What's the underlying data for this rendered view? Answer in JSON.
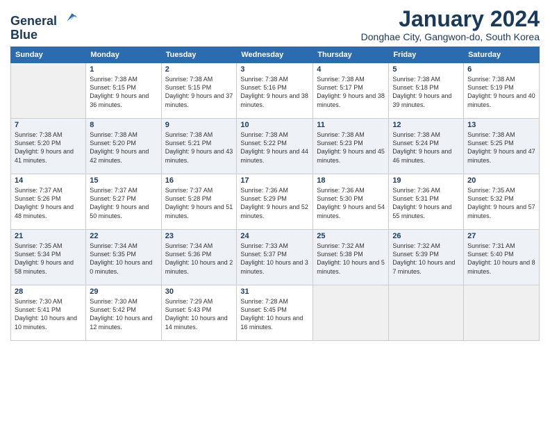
{
  "logo": {
    "line1": "General",
    "line2": "Blue"
  },
  "title": "January 2024",
  "subtitle": "Donghae City, Gangwon-do, South Korea",
  "days_of_week": [
    "Sunday",
    "Monday",
    "Tuesday",
    "Wednesday",
    "Thursday",
    "Friday",
    "Saturday"
  ],
  "weeks": [
    [
      {
        "empty": true
      },
      {
        "date": "1",
        "sunrise": "7:38 AM",
        "sunset": "5:15 PM",
        "daylight": "9 hours and 36 minutes."
      },
      {
        "date": "2",
        "sunrise": "7:38 AM",
        "sunset": "5:15 PM",
        "daylight": "9 hours and 37 minutes."
      },
      {
        "date": "3",
        "sunrise": "7:38 AM",
        "sunset": "5:16 PM",
        "daylight": "9 hours and 38 minutes."
      },
      {
        "date": "4",
        "sunrise": "7:38 AM",
        "sunset": "5:17 PM",
        "daylight": "9 hours and 38 minutes."
      },
      {
        "date": "5",
        "sunrise": "7:38 AM",
        "sunset": "5:18 PM",
        "daylight": "9 hours and 39 minutes."
      },
      {
        "date": "6",
        "sunrise": "7:38 AM",
        "sunset": "5:19 PM",
        "daylight": "9 hours and 40 minutes."
      }
    ],
    [
      {
        "date": "7",
        "sunrise": "7:38 AM",
        "sunset": "5:20 PM",
        "daylight": "9 hours and 41 minutes."
      },
      {
        "date": "8",
        "sunrise": "7:38 AM",
        "sunset": "5:20 PM",
        "daylight": "9 hours and 42 minutes."
      },
      {
        "date": "9",
        "sunrise": "7:38 AM",
        "sunset": "5:21 PM",
        "daylight": "9 hours and 43 minutes."
      },
      {
        "date": "10",
        "sunrise": "7:38 AM",
        "sunset": "5:22 PM",
        "daylight": "9 hours and 44 minutes."
      },
      {
        "date": "11",
        "sunrise": "7:38 AM",
        "sunset": "5:23 PM",
        "daylight": "9 hours and 45 minutes."
      },
      {
        "date": "12",
        "sunrise": "7:38 AM",
        "sunset": "5:24 PM",
        "daylight": "9 hours and 46 minutes."
      },
      {
        "date": "13",
        "sunrise": "7:38 AM",
        "sunset": "5:25 PM",
        "daylight": "9 hours and 47 minutes."
      }
    ],
    [
      {
        "date": "14",
        "sunrise": "7:37 AM",
        "sunset": "5:26 PM",
        "daylight": "9 hours and 48 minutes."
      },
      {
        "date": "15",
        "sunrise": "7:37 AM",
        "sunset": "5:27 PM",
        "daylight": "9 hours and 50 minutes."
      },
      {
        "date": "16",
        "sunrise": "7:37 AM",
        "sunset": "5:28 PM",
        "daylight": "9 hours and 51 minutes."
      },
      {
        "date": "17",
        "sunrise": "7:36 AM",
        "sunset": "5:29 PM",
        "daylight": "9 hours and 52 minutes."
      },
      {
        "date": "18",
        "sunrise": "7:36 AM",
        "sunset": "5:30 PM",
        "daylight": "9 hours and 54 minutes."
      },
      {
        "date": "19",
        "sunrise": "7:36 AM",
        "sunset": "5:31 PM",
        "daylight": "9 hours and 55 minutes."
      },
      {
        "date": "20",
        "sunrise": "7:35 AM",
        "sunset": "5:32 PM",
        "daylight": "9 hours and 57 minutes."
      }
    ],
    [
      {
        "date": "21",
        "sunrise": "7:35 AM",
        "sunset": "5:34 PM",
        "daylight": "9 hours and 58 minutes."
      },
      {
        "date": "22",
        "sunrise": "7:34 AM",
        "sunset": "5:35 PM",
        "daylight": "10 hours and 0 minutes."
      },
      {
        "date": "23",
        "sunrise": "7:34 AM",
        "sunset": "5:36 PM",
        "daylight": "10 hours and 2 minutes."
      },
      {
        "date": "24",
        "sunrise": "7:33 AM",
        "sunset": "5:37 PM",
        "daylight": "10 hours and 3 minutes."
      },
      {
        "date": "25",
        "sunrise": "7:32 AM",
        "sunset": "5:38 PM",
        "daylight": "10 hours and 5 minutes."
      },
      {
        "date": "26",
        "sunrise": "7:32 AM",
        "sunset": "5:39 PM",
        "daylight": "10 hours and 7 minutes."
      },
      {
        "date": "27",
        "sunrise": "7:31 AM",
        "sunset": "5:40 PM",
        "daylight": "10 hours and 8 minutes."
      }
    ],
    [
      {
        "date": "28",
        "sunrise": "7:30 AM",
        "sunset": "5:41 PM",
        "daylight": "10 hours and 10 minutes."
      },
      {
        "date": "29",
        "sunrise": "7:30 AM",
        "sunset": "5:42 PM",
        "daylight": "10 hours and 12 minutes."
      },
      {
        "date": "30",
        "sunrise": "7:29 AM",
        "sunset": "5:43 PM",
        "daylight": "10 hours and 14 minutes."
      },
      {
        "date": "31",
        "sunrise": "7:28 AM",
        "sunset": "5:45 PM",
        "daylight": "10 hours and 16 minutes."
      },
      {
        "empty": true
      },
      {
        "empty": true
      },
      {
        "empty": true
      }
    ]
  ],
  "labels": {
    "sunrise_prefix": "Sunrise: ",
    "sunset_prefix": "Sunset: ",
    "daylight_prefix": "Daylight: "
  }
}
